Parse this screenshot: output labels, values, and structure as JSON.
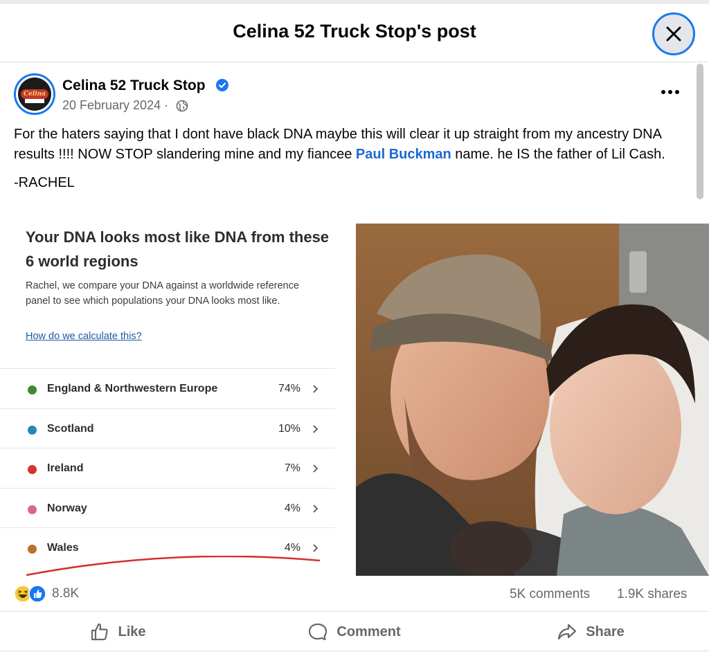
{
  "modal": {
    "title": "Celina 52 Truck Stop's post"
  },
  "post": {
    "author": "Celina 52 Truck Stop",
    "avatar_text": "Celina",
    "date": "20 February 2024",
    "date_separator": " · ",
    "privacy_icon": "globe-icon",
    "text_before_mention": "For the haters saying that I dont have black DNA maybe this will clear it up straight from my ancestry DNA results !!!! NOW STOP slandering mine and my fiancee ",
    "mention": "Paul Buckman",
    "text_after_mention": " name. he IS the father of Lil Cash.",
    "signature": "-RACHEL"
  },
  "dna_card": {
    "title": "Your DNA looks most like DNA from these 6 world regions",
    "description": "Rachel, we compare your DNA against a worldwide reference panel to see which populations your DNA looks most like.",
    "link": "How do we calculate this?",
    "regions": [
      {
        "name": "England & Northwestern Europe",
        "percent": "74%",
        "color": "#3e8a2c"
      },
      {
        "name": "Scotland",
        "percent": "10%",
        "color": "#2a86b8"
      },
      {
        "name": "Ireland",
        "percent": "7%",
        "color": "#d7322b"
      },
      {
        "name": "Norway",
        "percent": "4%",
        "color": "#d46b84"
      },
      {
        "name": "Wales",
        "percent": "4%",
        "color": "#b8742a"
      }
    ]
  },
  "stats": {
    "reaction_count": "8.8K",
    "comments": "5K comments",
    "shares": "1.9K shares"
  },
  "actions": {
    "like": "Like",
    "comment": "Comment",
    "share": "Share"
  },
  "colors": {
    "accent": "#1877f2",
    "mention": "#1a69d0",
    "secondary_text": "#65676b"
  }
}
